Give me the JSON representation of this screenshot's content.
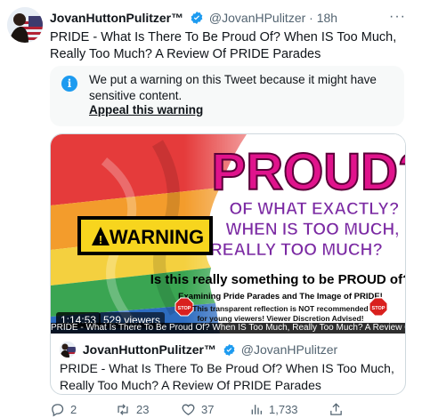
{
  "tweet": {
    "author_name": "JovanHuttonPulitzer™",
    "handle": "@JovanHPulitzer",
    "separator": "·",
    "time": "18h",
    "more_label": "···",
    "text": "PRIDE  - What Is There To Be Proud Of? When IS Too Much, Really Too Much? A Review Of PRIDE Parades"
  },
  "warning": {
    "icon_label": "i",
    "text": "We put a warning on this Tweet because it might have sensitive content.",
    "appeal_label": "Appeal this warning"
  },
  "media": {
    "headline": "PROUD?",
    "subheadline_lines": [
      "OF WHAT EXACTLY?",
      "WHEN IS TOO MUCH,",
      "REALLY TOO MUCH?"
    ],
    "warning_sign": "WARNING",
    "question": "Is this really something to be PROUD of?",
    "examining": "Examining Pride Parades and The Image of PRIDE!",
    "disclaimer_lines": [
      "This transparent reflection is NOT recommended",
      "for young viewers!  Viewer Discretion Advised!"
    ],
    "stop_label": "STOP",
    "timecode": "1:14:53",
    "viewers": "529 viewers",
    "caption": "PRIDE - What Is There To Be Proud Of? When IS Too Much, Really Too Much? A Review Of PRIDE Parade"
  },
  "quoted": {
    "author_name": "JovanHuttonPulitzer™",
    "handle": "@JovanHPulitzer",
    "text": "PRIDE - What Is There To Be Proud Of? When IS Too Much, Really Too Much? A Review Of PRIDE Parades"
  },
  "actions": {
    "replies": "2",
    "retweets": "23",
    "likes": "37",
    "views": "1,733"
  },
  "colors": {
    "accent": "#1d9bf0",
    "muted": "#536471",
    "headline_pink": "#e0138c",
    "sub_purple": "#7b2aa3",
    "stop_red": "#d9201e"
  }
}
